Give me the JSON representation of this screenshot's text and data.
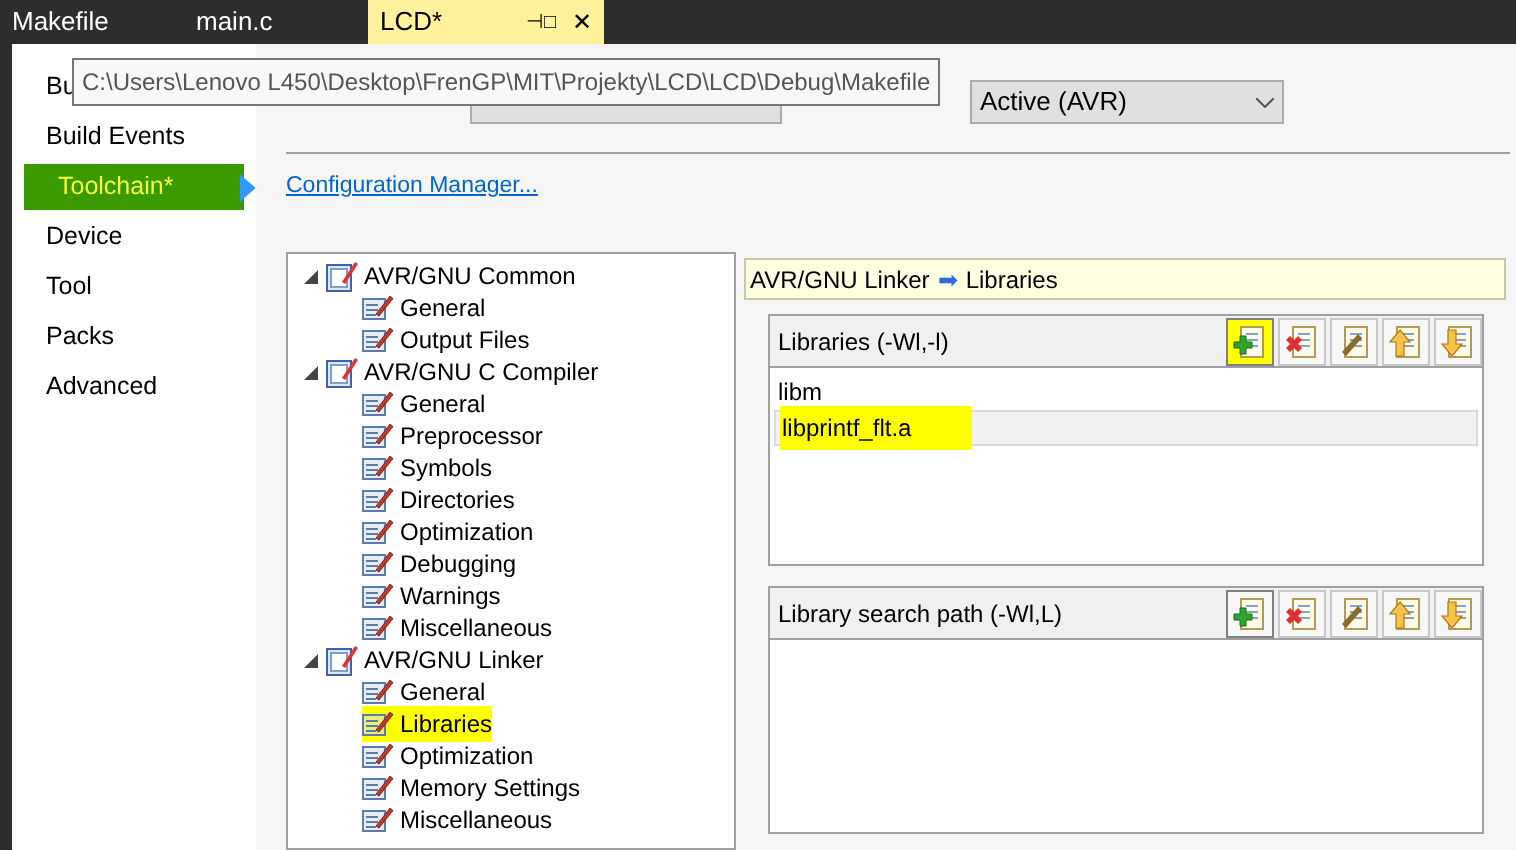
{
  "tabs": [
    {
      "label": "Makefile",
      "selected": false
    },
    {
      "label": "main.c",
      "selected": false
    },
    {
      "label": "LCD*",
      "selected": true,
      "pin": "⊣□",
      "close": "✕"
    }
  ],
  "tooltip": "C:\\Users\\Lenovo L450\\Desktop\\FrenGP\\MIT\\Projekty\\LCD\\LCD\\Debug\\Makefile",
  "sidebar": {
    "items": [
      {
        "label": "Bu",
        "selected": false,
        "highlighted": false
      },
      {
        "label": "Build Events",
        "selected": false,
        "highlighted": false
      },
      {
        "label": "Toolchain*",
        "selected": true,
        "highlighted": true
      },
      {
        "label": "Device",
        "selected": false,
        "highlighted": false
      },
      {
        "label": "Tool",
        "selected": false,
        "highlighted": false
      },
      {
        "label": "Packs",
        "selected": false,
        "highlighted": false
      },
      {
        "label": "Advanced",
        "selected": false,
        "highlighted": false
      }
    ]
  },
  "platform": {
    "value": "Active (AVR)"
  },
  "config_manager_link": "Configuration Manager...",
  "tree": [
    {
      "label": "AVR/GNU Common",
      "expanded": true,
      "children": [
        {
          "label": "General",
          "highlighted": false
        },
        {
          "label": "Output Files",
          "highlighted": false
        }
      ]
    },
    {
      "label": "AVR/GNU C Compiler",
      "expanded": true,
      "children": [
        {
          "label": "General",
          "highlighted": false
        },
        {
          "label": "Preprocessor",
          "highlighted": false
        },
        {
          "label": "Symbols",
          "highlighted": false
        },
        {
          "label": "Directories",
          "highlighted": false
        },
        {
          "label": "Optimization",
          "highlighted": false
        },
        {
          "label": "Debugging",
          "highlighted": false
        },
        {
          "label": "Warnings",
          "highlighted": false
        },
        {
          "label": "Miscellaneous",
          "highlighted": false
        }
      ]
    },
    {
      "label": "AVR/GNU Linker",
      "expanded": true,
      "children": [
        {
          "label": "General",
          "highlighted": false
        },
        {
          "label": "Libraries",
          "highlighted": true
        },
        {
          "label": "Optimization",
          "highlighted": false
        },
        {
          "label": "Memory Settings",
          "highlighted": false
        },
        {
          "label": "Miscellaneous",
          "highlighted": false
        }
      ]
    }
  ],
  "breadcrumb": {
    "parent": "AVR/GNU Linker",
    "arrow": "➡",
    "current": "Libraries"
  },
  "lists": [
    {
      "title": "Libraries (-Wl,-l)",
      "add_highlighted": true,
      "items": [
        {
          "label": "libm",
          "selected": false,
          "highlighted": false
        },
        {
          "label": "libprintf_flt.a",
          "selected": true,
          "highlighted": true
        }
      ]
    },
    {
      "title": "Library search path (-Wl,L)",
      "add_highlighted": false
    }
  ]
}
